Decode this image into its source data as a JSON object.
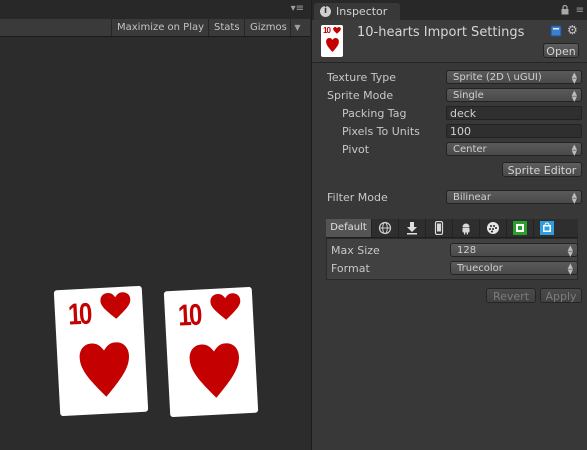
{
  "game_view": {
    "toolbar": {
      "maximize_on_play": "Maximize on Play",
      "stats": "Stats",
      "gizmos": "Gizmos"
    },
    "cards": [
      {
        "rank": "10",
        "suit": "hearts"
      },
      {
        "rank": "10",
        "suit": "hearts"
      }
    ]
  },
  "inspector": {
    "tab_label": "Inspector",
    "asset": {
      "thumb_rank": "10",
      "title": "10-hearts Import Settings",
      "open_button": "Open"
    },
    "properties": {
      "texture_type": {
        "label": "Texture Type",
        "value": "Sprite (2D \\ uGUI)"
      },
      "sprite_mode": {
        "label": "Sprite Mode",
        "value": "Single"
      },
      "packing_tag": {
        "label": "Packing Tag",
        "value": "deck"
      },
      "pixels_to_units": {
        "label": "Pixels To Units",
        "value": "100"
      },
      "pivot": {
        "label": "Pivot",
        "value": "Center"
      },
      "sprite_editor_button": "Sprite Editor",
      "filter_mode": {
        "label": "Filter Mode",
        "value": "Bilinear"
      }
    },
    "platform_tabs": {
      "default_label": "Default",
      "icons": [
        "globe-icon",
        "download-icon",
        "phone-icon",
        "android-icon",
        "blackberry-icon",
        "xbox-icon",
        "windows-store-icon"
      ]
    },
    "platform_settings": {
      "max_size": {
        "label": "Max Size",
        "value": "128"
      },
      "format": {
        "label": "Format",
        "value": "Truecolor"
      }
    },
    "revert_button": "Revert",
    "apply_button": "Apply"
  },
  "colors": {
    "heart_red": "#c40000",
    "xbox_green": "#2aa02a",
    "windows_blue": "#2f9ee0"
  }
}
